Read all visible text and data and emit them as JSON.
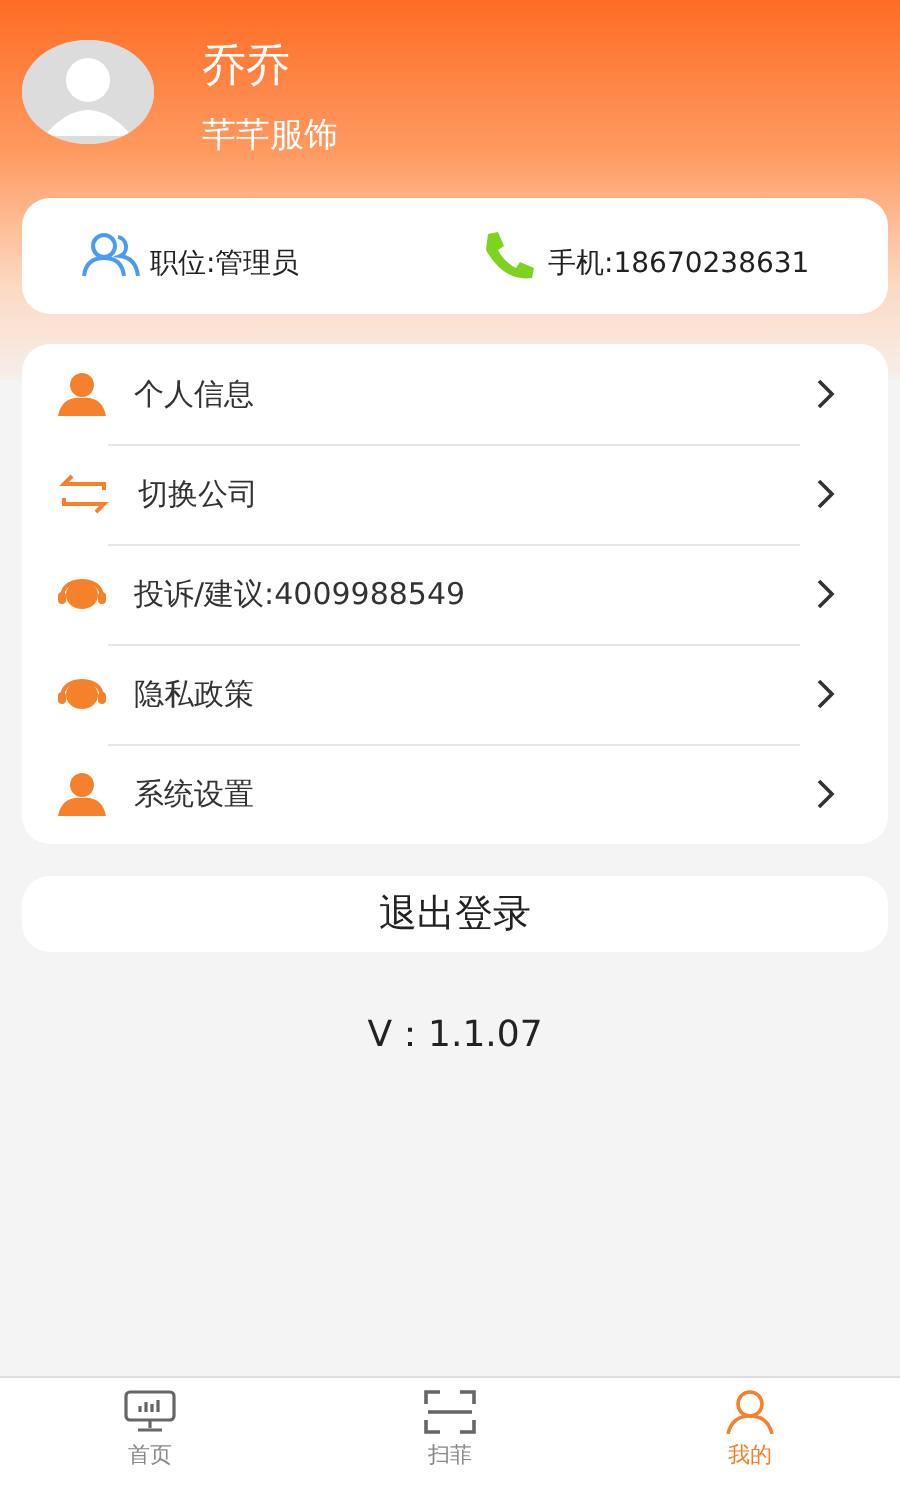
{
  "profile": {
    "name": "乔乔",
    "company": "芊芊服饰"
  },
  "info": {
    "position": "职位:管理员",
    "phone": "手机:18670238631"
  },
  "menu": [
    {
      "kind": "person",
      "label": "个人信息"
    },
    {
      "kind": "swap",
      "label": "切换公司"
    },
    {
      "kind": "headset",
      "label": "投诉/建议:4009988549"
    },
    {
      "kind": "headset",
      "label": "隐私政策"
    },
    {
      "kind": "person",
      "label": "系统设置"
    }
  ],
  "logout": "退出登录",
  "version": "V：1.1.07",
  "tabs": [
    {
      "kind": "monitor",
      "label": "首页",
      "selected": false
    },
    {
      "kind": "scan",
      "label": "扫菲",
      "selected": false
    },
    {
      "kind": "user",
      "label": "我的",
      "selected": true
    }
  ]
}
